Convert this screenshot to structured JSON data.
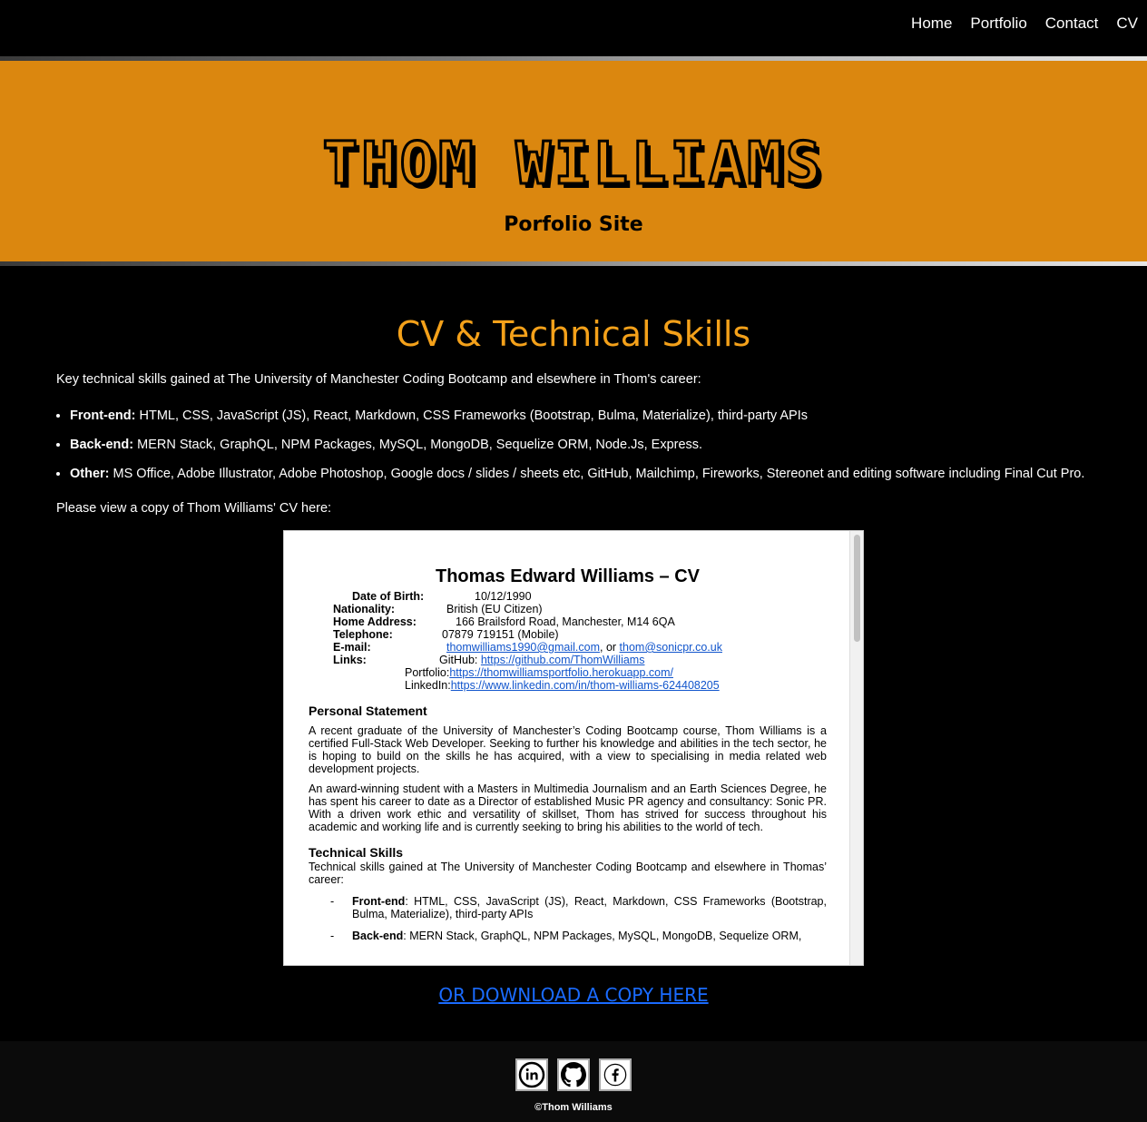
{
  "nav": {
    "items": [
      "Home",
      "Portfolio",
      "Contact",
      "CV"
    ]
  },
  "hero": {
    "title": "Thom Williams",
    "subtitle": "Porfolio Site"
  },
  "main": {
    "heading": "CV & Technical Skills",
    "intro": "Key technical skills gained at The University of Manchester Coding Bootcamp and elsewhere in Thom's career:",
    "skills": [
      {
        "label": "Front-end:",
        "text": " HTML, CSS, JavaScript (JS), React, Markdown, CSS Frameworks (Bootstrap, Bulma, Materialize), third-party APIs"
      },
      {
        "label": "Back-end:",
        "text": " MERN Stack, GraphQL, NPM Packages, MySQL, MongoDB, Sequelize ORM, Node.Js, Express."
      },
      {
        "label": "Other:",
        "text": " MS Office, Adobe Illustrator, Adobe Photoshop, Google docs / slides / sheets etc, GitHub, Mailchimp, Fireworks, Stereonet and editing software including Final Cut Pro."
      }
    ],
    "cv_note": "Please view a copy of Thom Williams' CV here:",
    "download_label": "OR DOWNLOAD A COPY HERE"
  },
  "cv_doc": {
    "title": "Thomas Edward Williams – CV",
    "dob_label": "Date of Birth:",
    "dob": "10/12/1990",
    "nationality_label": "Nationality:",
    "nationality": "British (EU Citizen)",
    "address_label": "Home Address:",
    "address": "166 Brailsford Road, Manchester, M14 6QA",
    "telephone_label": "Telephone:",
    "telephone": "07879 719151 (Mobile)",
    "email_label": "E-mail:",
    "email1": "thomwilliams1990@gmail.com",
    "email_sep": ", or ",
    "email2": "thom@sonicpr.co.uk",
    "links_label": "Links:",
    "github_label": "GitHub: ",
    "github": "https://github.com/ThomWilliams",
    "portfolio_label": "Portfolio: ",
    "portfolio": "https://thomwilliamsportfolio.herokuapp.com/",
    "linkedin_label": "LinkedIn: ",
    "linkedin": "https://www.linkedin.com/in/thom-williams-624408205",
    "ps_heading": "Personal Statement",
    "ps_p1": "A recent graduate of the University of Manchester’s Coding Bootcamp course, Thom Williams is a certified Full-Stack Web Developer. Seeking to further his knowledge and abilities in the tech sector, he is hoping to build on the skills he has acquired, with a view to specialising in media related web development projects.",
    "ps_p2": "An award-winning student with a Masters in Multimedia Journalism and an Earth Sciences Degree, he has spent his career to date as a Director of established Music PR agency and consultancy: Sonic PR. With a driven work ethic and versatility of skillset, Thom has strived for success throughout his academic and working life and is currently seeking to bring his abilities to the world of tech.",
    "ts_heading": "Technical Skills",
    "ts_intro": "Technical skills gained at The University of Manchester Coding Bootcamp and elsewhere in Thomas’ career:",
    "ts_items": [
      {
        "label": "Front-end",
        "text": ": HTML, CSS, JavaScript (JS), React, Markdown, CSS Frameworks (Bootstrap, Bulma, Materialize), third-party APIs"
      },
      {
        "label": "Back-end",
        "text": ": MERN Stack, GraphQL, NPM Packages, MySQL, MongoDB, Sequelize ORM,"
      }
    ],
    "dash": "-"
  },
  "footer": {
    "icons": [
      "linkedin-icon",
      "github-icon",
      "facebook-icon"
    ],
    "copyright": "©Thom Williams"
  },
  "colors": {
    "hero_bg": "#db870f",
    "heading": "#f4a11a",
    "link": "#1a6bff"
  }
}
